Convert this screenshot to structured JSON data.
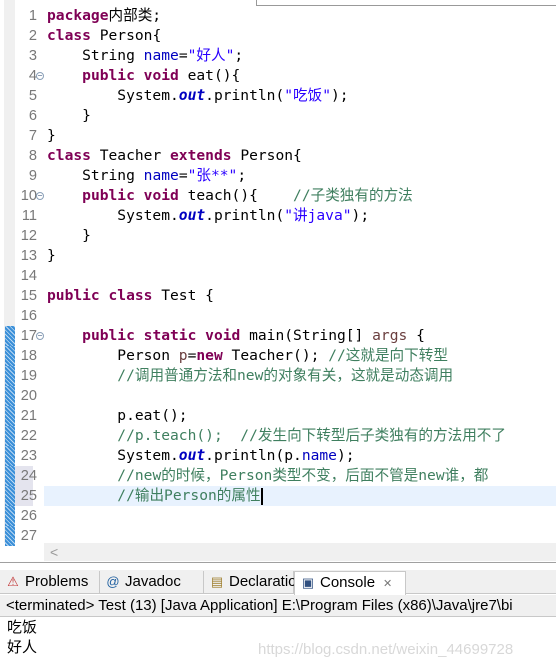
{
  "editor": {
    "current_line": 25,
    "lines": [
      {
        "n": "1",
        "t": [
          [
            "kw",
            "package"
          ],
          [
            "",
            "内部类;"
          ]
        ]
      },
      {
        "n": "2",
        "t": [
          [
            "kw",
            "class"
          ],
          [
            "",
            " Person{"
          ]
        ]
      },
      {
        "n": "3",
        "t": [
          [
            "",
            "    String "
          ],
          [
            "fld",
            "name"
          ],
          [
            "",
            "="
          ],
          [
            "str",
            "\"好人\""
          ],
          [
            "",
            ";"
          ]
        ]
      },
      {
        "n": "4",
        "fold": true,
        "t": [
          [
            "",
            "    "
          ],
          [
            "kw",
            "public"
          ],
          [
            "",
            ""
          ],
          [
            "kw",
            " void"
          ],
          [
            "",
            " eat(){"
          ]
        ]
      },
      {
        "n": "5",
        "t": [
          [
            "",
            "        System."
          ],
          [
            "sf",
            "out"
          ],
          [
            "",
            ".println("
          ],
          [
            "str",
            "\"吃饭\""
          ],
          [
            "",
            ");"
          ]
        ]
      },
      {
        "n": "6",
        "t": [
          [
            "",
            "    }"
          ]
        ]
      },
      {
        "n": "7",
        "t": [
          [
            "",
            "}"
          ]
        ]
      },
      {
        "n": "8",
        "t": [
          [
            "kw",
            "class"
          ],
          [
            "",
            " Teacher "
          ],
          [
            "kw",
            "extends"
          ],
          [
            "",
            " Person{"
          ]
        ]
      },
      {
        "n": "9",
        "t": [
          [
            "",
            "    String "
          ],
          [
            "fld",
            "name"
          ],
          [
            "",
            "="
          ],
          [
            "str",
            "\"张**\""
          ],
          [
            "",
            ";"
          ]
        ]
      },
      {
        "n": "10",
        "fold": true,
        "t": [
          [
            "",
            "    "
          ],
          [
            "kw",
            "public"
          ],
          [
            "kw",
            " void"
          ],
          [
            "",
            " teach(){    "
          ],
          [
            "cm",
            "//子类独有的方法"
          ]
        ]
      },
      {
        "n": "11",
        "t": [
          [
            "",
            "        System."
          ],
          [
            "sf",
            "out"
          ],
          [
            "",
            ".println("
          ],
          [
            "str",
            "\"讲java\""
          ],
          [
            "",
            ");"
          ]
        ]
      },
      {
        "n": "12",
        "t": [
          [
            "",
            "    }"
          ]
        ]
      },
      {
        "n": "13",
        "t": [
          [
            "",
            "}"
          ]
        ]
      },
      {
        "n": "14",
        "t": []
      },
      {
        "n": "15",
        "t": [
          [
            "kw",
            "public"
          ],
          [
            "kw",
            " class"
          ],
          [
            "",
            " Test {"
          ]
        ]
      },
      {
        "n": "16",
        "t": []
      },
      {
        "n": "17",
        "fold": true,
        "mark": true,
        "t": [
          [
            "",
            "    "
          ],
          [
            "kw",
            "public"
          ],
          [
            "kw",
            " static"
          ],
          [
            "kw",
            " void"
          ],
          [
            "",
            " main(String[] "
          ],
          [
            "lv",
            "args"
          ],
          [
            "",
            " {"
          ]
        ]
      },
      {
        "n": "18",
        "mark": true,
        "t": [
          [
            "",
            "        Person "
          ],
          [
            "lv",
            "p"
          ],
          [
            "",
            "="
          ],
          [
            "kw",
            "new"
          ],
          [
            "",
            " Teacher(); "
          ],
          [
            "cm",
            "//这就是向下转型"
          ]
        ]
      },
      {
        "n": "19",
        "mark": true,
        "t": [
          [
            "",
            "        "
          ],
          [
            "cm",
            "//调用普通方法和new的对象有关，这就是动态调用"
          ]
        ]
      },
      {
        "n": "20",
        "mark": true,
        "t": []
      },
      {
        "n": "21",
        "mark": true,
        "t": [
          [
            "",
            "        p.eat();"
          ]
        ]
      },
      {
        "n": "22",
        "mark": true,
        "t": [
          [
            "",
            "        "
          ],
          [
            "cm",
            "//p.teach();  //发生向下转型后子类独有的方法用不了"
          ]
        ]
      },
      {
        "n": "23",
        "mark": true,
        "t": [
          [
            "",
            "        System."
          ],
          [
            "sf",
            "out"
          ],
          [
            "",
            ".println(p."
          ],
          [
            "fld",
            "name"
          ],
          [
            "",
            ");"
          ]
        ]
      },
      {
        "n": "24",
        "mark": true,
        "t": [
          [
            "",
            "        "
          ],
          [
            "cm",
            "//new的时候，Person类型不变，后面不管是new谁，都"
          ]
        ]
      },
      {
        "n": "25",
        "mark": true,
        "t": [
          [
            "",
            "        "
          ],
          [
            "cm",
            "//输出Person的属性"
          ]
        ]
      },
      {
        "n": "26",
        "mark": true,
        "t": []
      },
      {
        "n": "27",
        "mark": true,
        "t": []
      }
    ]
  },
  "scroll_left": "<",
  "tabs": [
    {
      "label": "Problems",
      "icon": "problems-icon",
      "glyph": "⚠"
    },
    {
      "label": "Javadoc",
      "icon": "at-icon",
      "glyph": "@"
    },
    {
      "label": "Declaration",
      "icon": "declaration-icon",
      "glyph": "▤"
    },
    {
      "label": "Console",
      "icon": "console-icon",
      "glyph": "▣",
      "active": true,
      "close": "✕"
    }
  ],
  "console": {
    "description": "<terminated> Test (13) [Java Application] E:\\Program Files (x86)\\Java\\jre7\\bi",
    "output": [
      "吃饭",
      "好人"
    ]
  },
  "watermark": "https://blog.csdn.net/weixin_44699728"
}
